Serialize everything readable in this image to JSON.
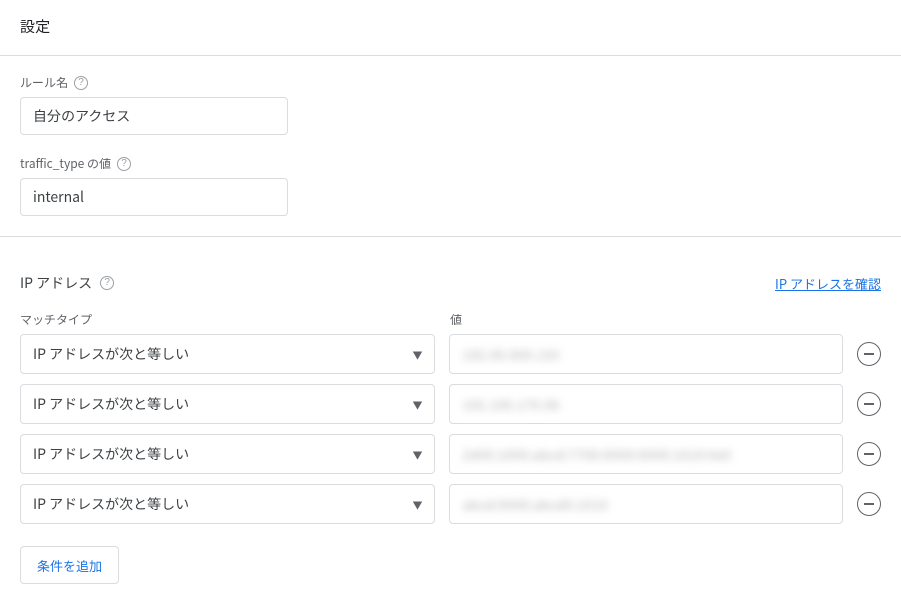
{
  "page": {
    "title": "設定"
  },
  "rule": {
    "name_label": "ルール名",
    "name_value": "自分のアクセス",
    "traffic_type_label": "traffic_type の値",
    "traffic_type_value": "internal"
  },
  "ip": {
    "header": "IP アドレス",
    "verify_link": "IP アドレスを確認",
    "match_label": "マッチタイプ",
    "value_label": "値",
    "rows": [
      {
        "match": "IP アドレスが次と等しい",
        "value": "192.00.000.155"
      },
      {
        "match": "IP アドレスが次と等しい",
        "value": "192.100.170.06"
      },
      {
        "match": "IP アドレスが次と等しい",
        "value": "2400:1000:abcd:7700:0000:0000:1010:0e0"
      },
      {
        "match": "IP アドレスが次と等しい",
        "value": "abcd:0000:abcd0:1010"
      }
    ],
    "add_label": "条件を追加"
  }
}
